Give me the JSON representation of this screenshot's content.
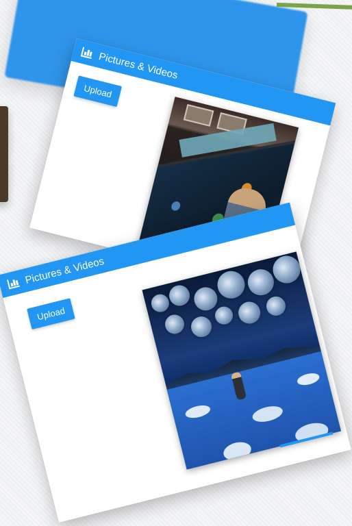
{
  "cards": [
    {
      "title": "Pictures & Videos",
      "upload_label": "Upload",
      "header_icon": "bar-chart-icon"
    },
    {
      "title": "Pictures & Videos",
      "upload_label": "Upload",
      "header_icon": "bar-chart-icon"
    }
  ],
  "colors": {
    "accent": "#2196f3",
    "background_splash": "#2f95ea",
    "green_accent": "#7aa34a"
  }
}
